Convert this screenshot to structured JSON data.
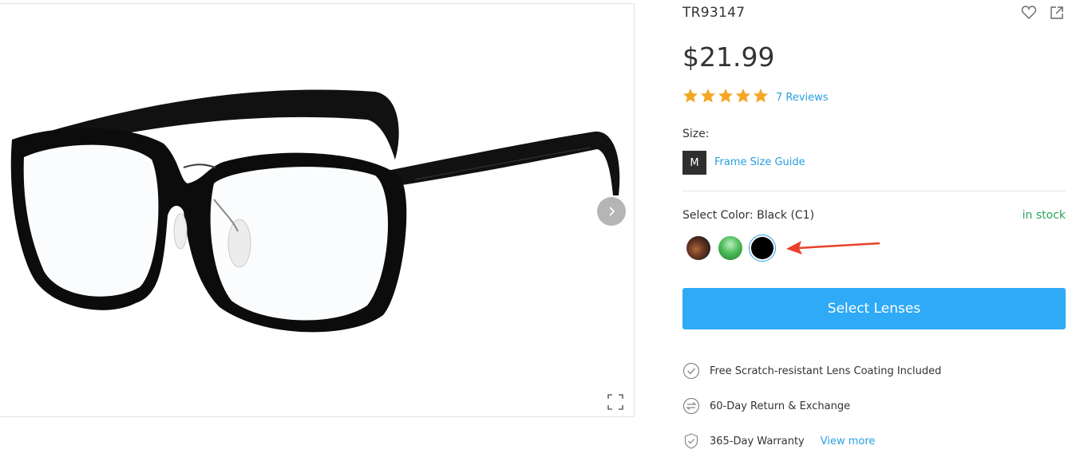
{
  "product": {
    "code": "TR93147",
    "price": "$21.99",
    "rating": 5,
    "reviews_label": "7 Reviews"
  },
  "size": {
    "label": "Size:",
    "selected": "M",
    "guide_label": "Frame Size Guide"
  },
  "color": {
    "label": "Select Color: Black (C1)",
    "stock": "in stock",
    "swatches": [
      "tortoise",
      "green",
      "black"
    ],
    "selected_index": 2
  },
  "cta": {
    "label": "Select Lenses"
  },
  "features": [
    {
      "icon": "check-circle-icon",
      "text": "Free Scratch-resistant Lens Coating Included"
    },
    {
      "icon": "exchange-icon",
      "text": "60-Day Return & Exchange"
    },
    {
      "icon": "shield-icon",
      "text": "365-Day Warranty",
      "link": "View more"
    }
  ],
  "colors": {
    "accent": "#2eaaf6",
    "link": "#2a9fe0",
    "star": "#f5a623",
    "stock": "#2aa65a",
    "annotation_arrow": "#e8412c"
  }
}
